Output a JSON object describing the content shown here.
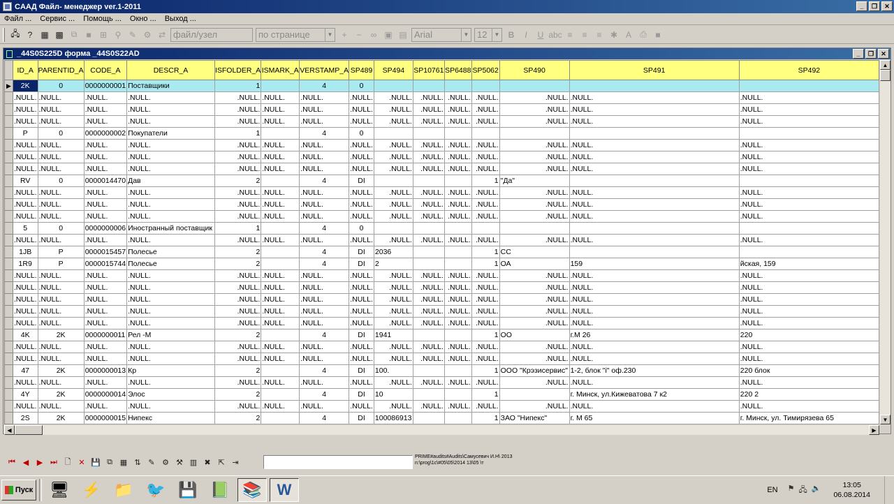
{
  "window": {
    "title": "CAAД Файл- менеджер ver.1-2011"
  },
  "menu": [
    "Файл ...",
    "Сервис ...",
    "Помощь ...",
    "Окно ...",
    "Выход ..."
  ],
  "toolbar": {
    "combo_field": "файл/узел",
    "combo_search": "по странице",
    "combo_font": "Arial",
    "combo_size": "12"
  },
  "child_window": {
    "title": "_44S0S225D форма _44S0S22AD"
  },
  "table": {
    "columns": [
      "ID_A",
      "PARENTID_A",
      "CODE_A",
      "DESCR_A",
      "ISFOLDER_A",
      "ISMARK_A",
      "VERSTAMP_A",
      "SP489",
      "SP494",
      "SP10761",
      "SP6488",
      "SP5062",
      "SP490",
      "SP491",
      "SP492"
    ],
    "rows": [
      [
        "2K",
        "0",
        "0000000001",
        "Поставщики",
        "1",
        "",
        "4",
        "0",
        "",
        "",
        "",
        "",
        "",
        "",
        ""
      ],
      [
        ".NULL.",
        ".NULL.",
        ".NULL.",
        ".NULL.",
        ".NULL.",
        ".NULL.",
        ".NULL.",
        ".NULL.",
        ".NULL.",
        ".NULL.",
        ".NULL.",
        ".NULL.",
        ".NULL.",
        ".NULL.",
        ".NULL."
      ],
      [
        ".NULL.",
        ".NULL.",
        ".NULL.",
        ".NULL.",
        ".NULL.",
        ".NULL.",
        ".NULL.",
        ".NULL.",
        ".NULL.",
        ".NULL.",
        ".NULL.",
        ".NULL.",
        ".NULL.",
        ".NULL.",
        ".NULL."
      ],
      [
        ".NULL.",
        ".NULL.",
        ".NULL.",
        ".NULL.",
        ".NULL.",
        ".NULL.",
        ".NULL.",
        ".NULL.",
        ".NULL.",
        ".NULL.",
        ".NULL.",
        ".NULL.",
        ".NULL.",
        ".NULL.",
        ".NULL."
      ],
      [
        "P",
        "0",
        "0000000002",
        "Покупатели",
        "1",
        "",
        "4",
        "0",
        "",
        "",
        "",
        "",
        "",
        "",
        ""
      ],
      [
        ".NULL.",
        ".NULL.",
        ".NULL.",
        ".NULL.",
        ".NULL.",
        ".NULL.",
        ".NULL.",
        ".NULL.",
        ".NULL.",
        ".NULL.",
        ".NULL.",
        ".NULL.",
        ".NULL.",
        ".NULL.",
        ".NULL."
      ],
      [
        ".NULL.",
        ".NULL.",
        ".NULL.",
        ".NULL.",
        ".NULL.",
        ".NULL.",
        ".NULL.",
        ".NULL.",
        ".NULL.",
        ".NULL.",
        ".NULL.",
        ".NULL.",
        ".NULL.",
        ".NULL.",
        ".NULL."
      ],
      [
        ".NULL.",
        ".NULL.",
        ".NULL.",
        ".NULL.",
        ".NULL.",
        ".NULL.",
        ".NULL.",
        ".NULL.",
        ".NULL.",
        ".NULL.",
        ".NULL.",
        ".NULL.",
        ".NULL.",
        ".NULL.",
        ".NULL."
      ],
      [
        "RV",
        "0",
        "0000014470",
        "Дав",
        "2",
        "",
        "4",
        "DI",
        "",
        "",
        "",
        "1",
        "\"Да\"",
        "",
        ""
      ],
      [
        ".NULL.",
        ".NULL.",
        ".NULL.",
        ".NULL.",
        ".NULL.",
        ".NULL.",
        ".NULL.",
        ".NULL.",
        ".NULL.",
        ".NULL.",
        ".NULL.",
        ".NULL.",
        ".NULL.",
        ".NULL.",
        ".NULL."
      ],
      [
        ".NULL.",
        ".NULL.",
        ".NULL.",
        ".NULL.",
        ".NULL.",
        ".NULL.",
        ".NULL.",
        ".NULL.",
        ".NULL.",
        ".NULL.",
        ".NULL.",
        ".NULL.",
        ".NULL.",
        ".NULL.",
        ".NULL."
      ],
      [
        ".NULL.",
        ".NULL.",
        ".NULL.",
        ".NULL.",
        ".NULL.",
        ".NULL.",
        ".NULL.",
        ".NULL.",
        ".NULL.",
        ".NULL.",
        ".NULL.",
        ".NULL.",
        ".NULL.",
        ".NULL.",
        ".NULL."
      ],
      [
        "5",
        "0",
        "0000000006",
        "Иностранный поставщик",
        "1",
        "",
        "4",
        "0",
        "",
        "",
        "",
        "",
        "",
        "",
        ""
      ],
      [
        ".NULL.",
        ".NULL.",
        ".NULL.",
        ".NULL.",
        ".NULL.",
        ".NULL.",
        ".NULL.",
        ".NULL.",
        ".NULL.",
        ".NULL.",
        ".NULL.",
        ".NULL.",
        ".NULL.",
        ".NULL.",
        ".NULL."
      ],
      [
        "1JB",
        "P",
        "0000015457",
        "Полесье",
        "2",
        "",
        "4",
        "DI",
        "2036",
        "",
        "",
        "1",
        "CC",
        "",
        ""
      ],
      [
        "1R9",
        "P",
        "0000015744",
        "Полесье",
        "2",
        "",
        "4",
        "DI",
        "2",
        "",
        "",
        "1",
        "ОА",
        "159",
        "йская, 159"
      ],
      [
        ".NULL.",
        ".NULL.",
        ".NULL.",
        ".NULL.",
        ".NULL.",
        ".NULL.",
        ".NULL.",
        ".NULL.",
        ".NULL.",
        ".NULL.",
        ".NULL.",
        ".NULL.",
        ".NULL.",
        ".NULL.",
        ".NULL."
      ],
      [
        ".NULL.",
        ".NULL.",
        ".NULL.",
        ".NULL.",
        ".NULL.",
        ".NULL.",
        ".NULL.",
        ".NULL.",
        ".NULL.",
        ".NULL.",
        ".NULL.",
        ".NULL.",
        ".NULL.",
        ".NULL.",
        ".NULL."
      ],
      [
        ".NULL.",
        ".NULL.",
        ".NULL.",
        ".NULL.",
        ".NULL.",
        ".NULL.",
        ".NULL.",
        ".NULL.",
        ".NULL.",
        ".NULL.",
        ".NULL.",
        ".NULL.",
        ".NULL.",
        ".NULL.",
        ".NULL."
      ],
      [
        ".NULL.",
        ".NULL.",
        ".NULL.",
        ".NULL.",
        ".NULL.",
        ".NULL.",
        ".NULL.",
        ".NULL.",
        ".NULL.",
        ".NULL.",
        ".NULL.",
        ".NULL.",
        ".NULL.",
        ".NULL.",
        ".NULL."
      ],
      [
        ".NULL.",
        ".NULL.",
        ".NULL.",
        ".NULL.",
        ".NULL.",
        ".NULL.",
        ".NULL.",
        ".NULL.",
        ".NULL.",
        ".NULL.",
        ".NULL.",
        ".NULL.",
        ".NULL.",
        ".NULL.",
        ".NULL."
      ],
      [
        "4K",
        "2K",
        "0000000011",
        "Рел -М",
        "2",
        "",
        "4",
        "DI",
        "1941",
        "",
        "",
        "1",
        "ОО",
        "г.М 26",
        "220"
      ],
      [
        ".NULL.",
        ".NULL.",
        ".NULL.",
        ".NULL.",
        ".NULL.",
        ".NULL.",
        ".NULL.",
        ".NULL.",
        ".NULL.",
        ".NULL.",
        ".NULL.",
        ".NULL.",
        ".NULL.",
        ".NULL.",
        ".NULL."
      ],
      [
        ".NULL.",
        ".NULL.",
        ".NULL.",
        ".NULL.",
        ".NULL.",
        ".NULL.",
        ".NULL.",
        ".NULL.",
        ".NULL.",
        ".NULL.",
        ".NULL.",
        ".NULL.",
        ".NULL.",
        ".NULL.",
        ".NULL."
      ],
      [
        "47",
        "2K",
        "0000000013",
        "Кр",
        "2",
        "",
        "4",
        "DI",
        "100.",
        "",
        "",
        "1",
        "ООО \"Крэзисервис\"",
        "1-2, блок \"і\" оф.230",
        "220 блок"
      ],
      [
        ".NULL.",
        ".NULL.",
        ".NULL.",
        ".NULL.",
        ".NULL.",
        ".NULL.",
        ".NULL.",
        ".NULL.",
        ".NULL.",
        ".NULL.",
        ".NULL.",
        ".NULL.",
        ".NULL.",
        ".NULL.",
        ".NULL."
      ],
      [
        "4Y",
        "2K",
        "0000000014",
        "Элос",
        "2",
        "",
        "4",
        "DI",
        "10",
        "",
        "",
        "1",
        "",
        "г. Минск, ул.Кижеватова 7 к2",
        "220 2"
      ],
      [
        ".NULL.",
        ".NULL.",
        ".NULL.",
        ".NULL.",
        ".NULL.",
        ".NULL.",
        ".NULL.",
        ".NULL.",
        ".NULL.",
        ".NULL.",
        ".NULL.",
        ".NULL.",
        ".NULL.",
        ".NULL.",
        ".NULL."
      ],
      [
        "2S",
        "2K",
        "0000000015",
        "Нипекс",
        "2",
        "",
        "4",
        "DI",
        "100086913",
        "",
        "",
        "1",
        "ЗАО \"Нипекс\"",
        "г. М 65",
        "г. Минск, ул. Тимирязева 65"
      ]
    ]
  },
  "status": {
    "path_line1": "PRIME#audits#Audits\\Самусевич И.Н\\ 2013",
    "path_line2": "n:\\prog\\1c\\#05\\05\\2014 13\\05 \\т"
  },
  "taskbar": {
    "start_label": "Пуск",
    "lang": "EN",
    "time": "13:05",
    "date": "06.08.2014"
  }
}
